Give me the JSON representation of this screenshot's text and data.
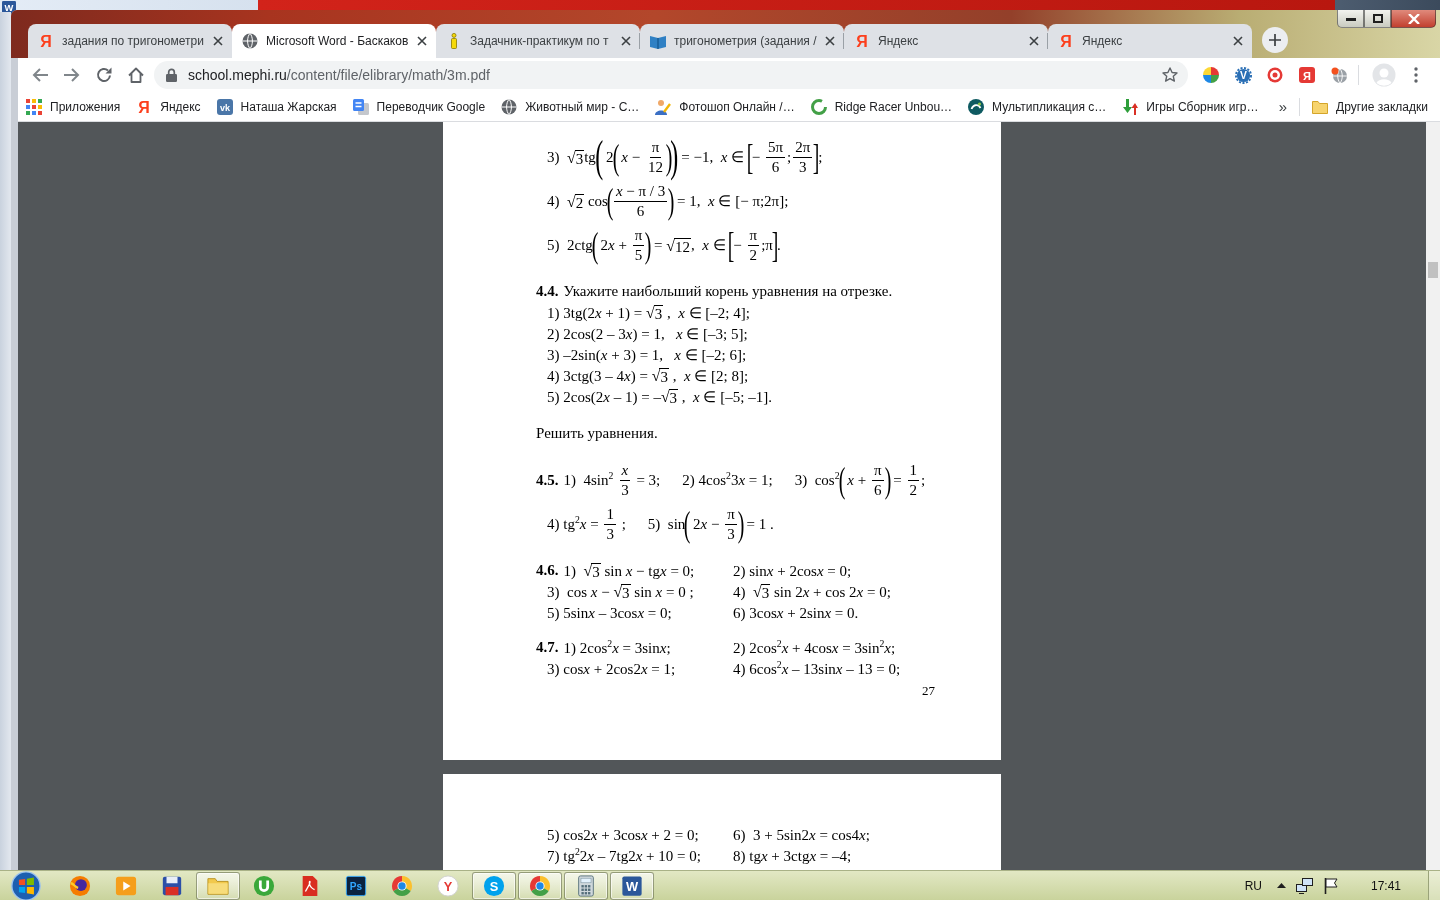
{
  "background_window": {
    "app_glyph": "W"
  },
  "browser": {
    "tabs": [
      {
        "title": "задания по тригонометри",
        "glyph": "Я",
        "selected": false
      },
      {
        "title": "Microsoft Word - Баскаков",
        "selected": true
      },
      {
        "title": "Задачник-практикум по т",
        "selected": false
      },
      {
        "title": "тригонометрия (задания /",
        "selected": false
      },
      {
        "title": "Яндекс",
        "glyph": "Я",
        "selected": false
      },
      {
        "title": "Яндекс",
        "glyph": "Я",
        "selected": false
      }
    ],
    "address_bar": {
      "secure": true,
      "host": "school.mephi.ru",
      "path": "/content/file/elibrary/math/3m.pdf"
    },
    "extension_glyphs": [
      "V",
      "Я"
    ],
    "bookmarks": [
      {
        "label": "Приложения"
      },
      {
        "label": "Яндекс",
        "glyph": "Я"
      },
      {
        "label": "Наташа Жарская",
        "glyph": "vk"
      },
      {
        "label": "Переводчик Google"
      },
      {
        "label": "Животный мир - С…"
      },
      {
        "label": "Фотошоп Онлайн /…"
      },
      {
        "label": "Ridge Racer Unbou…"
      },
      {
        "label": "Мультипликация с…"
      },
      {
        "label": "Игры Сборник игр…"
      }
    ],
    "bookmarks_more": "»",
    "other_bookmarks": "Другие закладки"
  },
  "pdf_viewer": {
    "pages": [
      {
        "blocks": [
          {
            "kind": "columns",
            "rows": [
              [
                {
                  "parts": [
                    "3)  ",
                    {
                      "kind": "root",
                      "sign": "√",
                      "body": "3"
                    },
                    "tg",
                    {
                      "kind": "group",
                      "open": "(",
                      "close": ")",
                      "body": [
                        " 2",
                        {
                          "kind": "group",
                          "open": "(",
                          "close": ")",
                          "body": [
                            " *x* − ",
                            {
                              "kind": "frac",
                              "num": "π",
                              "den": "12"
                            }
                          ]
                        }
                      ]
                    },
                    " = −1,  *x* ∈ ",
                    {
                      "kind": "group",
                      "open": "[",
                      "close": "]",
                      "body": [
                        "− ",
                        {
                          "kind": "frac",
                          "num": "5π",
                          "den": "6"
                        },
                        ";",
                        {
                          "kind": "frac",
                          "num": "2π",
                          "den": "3"
                        }
                      ]
                    },
                    ";"
                  ]
                }
              ],
              [
                {
                  "parts": [
                    "4)  ",
                    {
                      "kind": "root",
                      "sign": "√",
                      "body": "2"
                    },
                    " cos",
                    {
                      "kind": "group",
                      "open": "(",
                      "close": ")",
                      "body": [
                        {
                          "kind": "frac",
                          "num": "*x* − π / 3",
                          "den": "6"
                        }
                      ]
                    },
                    " = 1,  *x* ∈ [− π;2π];"
                  ]
                }
              ],
              [
                {
                  "parts": [
                    "5)  2ctg",
                    {
                      "kind": "group",
                      "open": "(",
                      "close": ")",
                      "body": [
                        " 2",
                        "*x* + ",
                        {
                          "kind": "frac",
                          "num": "π",
                          "den": "5"
                        }
                      ]
                    },
                    " = ",
                    {
                      "kind": "root",
                      "sign": "√",
                      "body": "12"
                    },
                    ",  *x* ∈ ",
                    {
                      "kind": "group",
                      "open": "[",
                      "close": "]",
                      "body": [
                        "− ",
                        {
                          "kind": "frac",
                          "num": "π",
                          "den": "2"
                        },
                        ";π"
                      ]
                    },
                    "."
                  ]
                }
              ]
            ]
          },
          {
            "kind": "columns",
            "number": "4.4.",
            "title": "Укажите наибольший корень уравнения на отрезке.",
            "rows": [
              [
                {
                  "parts": [
                    "1) 3tg(2",
                    "*x* + 1) = ",
                    {
                      "kind": "root",
                      "sign": "√",
                      "body": "3"
                    },
                    " ,  *x* ∈ [–2; 4];"
                  ]
                }
              ],
              [
                {
                  "parts": [
                    "2) 2cos(2 – 3",
                    "*x*) = 1,   *x* ∈ [–3; 5];"
                  ]
                }
              ],
              [
                {
                  "parts": [
                    "3) –2sin(*x* + 3) = 1,   *x* ∈ [–2; 6];"
                  ]
                }
              ],
              [
                {
                  "parts": [
                    "4) 3ctg(3 – 4",
                    "*x*) = ",
                    {
                      "kind": "root",
                      "sign": "√",
                      "body": "3"
                    },
                    " ,  *x* ∈ [2; 8];"
                  ]
                }
              ],
              [
                {
                  "parts": [
                    "5) 2cos(2",
                    "*x* – 1) = –",
                    {
                      "kind": "root",
                      "sign": "√",
                      "body": "3"
                    },
                    " ,  *x* ∈ [–5; –1]."
                  ]
                }
              ]
            ]
          },
          {
            "kind": "text",
            "text": "Решить уравнения."
          },
          {
            "kind": "inline",
            "number": "4.5.",
            "rows": [
              [
                {
                  "parts": [
                    "1)  4sin$^{2}$ ",
                    {
                      "kind": "frac",
                      "num": "*x*",
                      "den": "3"
                    },
                    " = 3;"
                  ]
                },
                {
                  "parts": [
                    "2) 4cos$^{2}$3",
                    "*x* = 1;"
                  ]
                },
                {
                  "parts": [
                    "3)  cos$^{2}$",
                    {
                      "kind": "group",
                      "open": "(",
                      "close": ")",
                      "body": [
                        " *x* + ",
                        {
                          "kind": "frac",
                          "num": "π",
                          "den": "6"
                        }
                      ]
                    },
                    " = ",
                    {
                      "kind": "frac",
                      "num": "1",
                      "den": "2"
                    },
                    ";"
                  ]
                }
              ],
              [
                {
                  "parts": [
                    "4) tg$^{2}$*x* = ",
                    {
                      "kind": "frac",
                      "num": "1",
                      "den": "3"
                    },
                    " ;"
                  ]
                },
                {
                  "parts": [
                    "5)  sin",
                    {
                      "kind": "group",
                      "open": "(",
                      "close": ")",
                      "body": [
                        " 2",
                        "*x* − ",
                        {
                          "kind": "frac",
                          "num": "π",
                          "den": "3"
                        }
                      ]
                    },
                    " = 1 ."
                  ]
                }
              ]
            ]
          },
          {
            "kind": "columns",
            "number": "4.6.",
            "rows": [
              [
                {
                  "parts": [
                    "1)  ",
                    {
                      "kind": "root",
                      "sign": "√",
                      "body": "3"
                    },
                    " sin *x* − tg",
                    "*x* = 0;"
                  ]
                },
                {
                  "parts": [
                    "2) sin",
                    "*x* + 2cos",
                    "*x* = 0;"
                  ]
                }
              ],
              [
                {
                  "parts": [
                    "3)  cos *x* − ",
                    {
                      "kind": "root",
                      "sign": "√",
                      "body": "3"
                    },
                    " sin *x* = 0 ;"
                  ]
                },
                {
                  "parts": [
                    "4)  ",
                    {
                      "kind": "root",
                      "sign": "√",
                      "body": "3"
                    },
                    " sin 2",
                    "*x* + cos 2",
                    "*x* = 0;"
                  ]
                }
              ],
              [
                {
                  "parts": [
                    "5) 5sin",
                    "*x* – 3cos",
                    "*x* = 0;"
                  ]
                },
                {
                  "parts": [
                    "6) 3cos",
                    "*x* + 2sin",
                    "*x* = 0."
                  ]
                }
              ]
            ]
          },
          {
            "kind": "columns",
            "number": "4.7.",
            "rows": [
              [
                {
                  "parts": [
                    "1) 2cos$^{2}$*x* = 3sin",
                    "*x*;"
                  ]
                },
                {
                  "parts": [
                    "2) 2cos$^{2}$*x* + 4cos",
                    "*x* = 3sin$^{2}$*x*;"
                  ]
                }
              ],
              [
                {
                  "parts": [
                    "3) cos",
                    "*x* + 2cos2",
                    "*x* = 1;"
                  ]
                },
                {
                  "parts": [
                    "4) 6cos$^{2}$*x* – 13sin",
                    "*x* – 13 = 0;"
                  ]
                }
              ]
            ]
          }
        ],
        "page_number": "27"
      },
      {
        "blocks": [
          {
            "kind": "columns",
            "rows": [
              [
                {
                  "parts": [
                    "5) cos2",
                    "*x* + 3cos",
                    "*x* + 2 = 0;"
                  ]
                },
                {
                  "parts": [
                    "6)  3 + 5sin2",
                    "*x* = cos4",
                    "*x*;"
                  ]
                }
              ],
              [
                {
                  "parts": [
                    "7) tg$^{2}$2",
                    "*x* – 7tg2",
                    "*x* + 10 = 0;"
                  ]
                },
                {
                  "parts": [
                    "8) tg",
                    "*x* + 3ctg",
                    "*x* = –4;"
                  ]
                }
              ]
            ]
          }
        ]
      }
    ]
  },
  "taskbar": {
    "apps": [
      {
        "running": false
      },
      {
        "running": false
      },
      {
        "running": false
      },
      {
        "running": true
      },
      {
        "running": false
      },
      {
        "running": false
      },
      {
        "glyph": "Ps",
        "running": false
      },
      {
        "running": false
      },
      {
        "glyph": "Y",
        "running": false
      },
      {
        "glyph": "S",
        "running": true
      },
      {
        "running": true
      },
      {
        "running": true
      },
      {
        "glyph": "W",
        "running": true
      }
    ],
    "language": "RU",
    "clock": "17:41"
  }
}
